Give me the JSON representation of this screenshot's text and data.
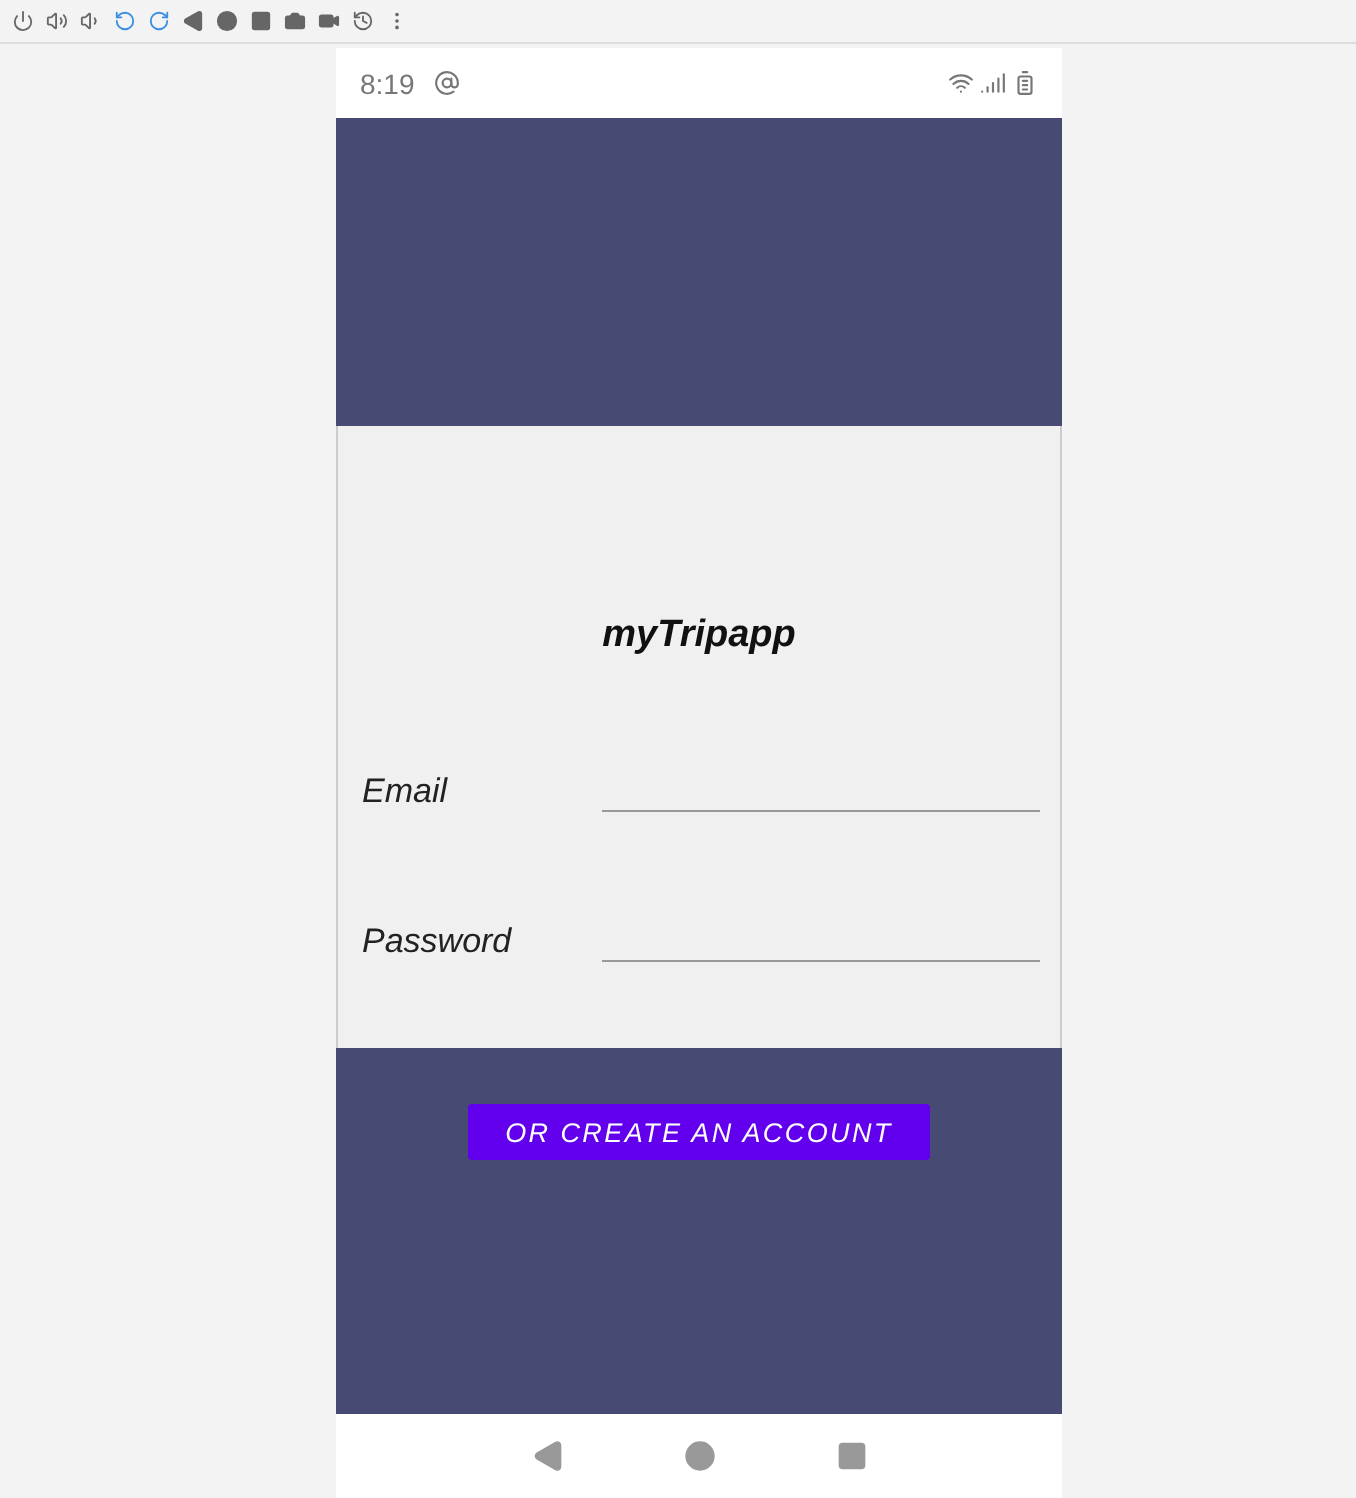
{
  "status_bar": {
    "time": "8:19"
  },
  "app_title": "myTripapp",
  "fields": [
    {
      "label": "Email"
    },
    {
      "label": "Password"
    }
  ],
  "create_account_button": "OR CREATE AN ACCOUNT"
}
